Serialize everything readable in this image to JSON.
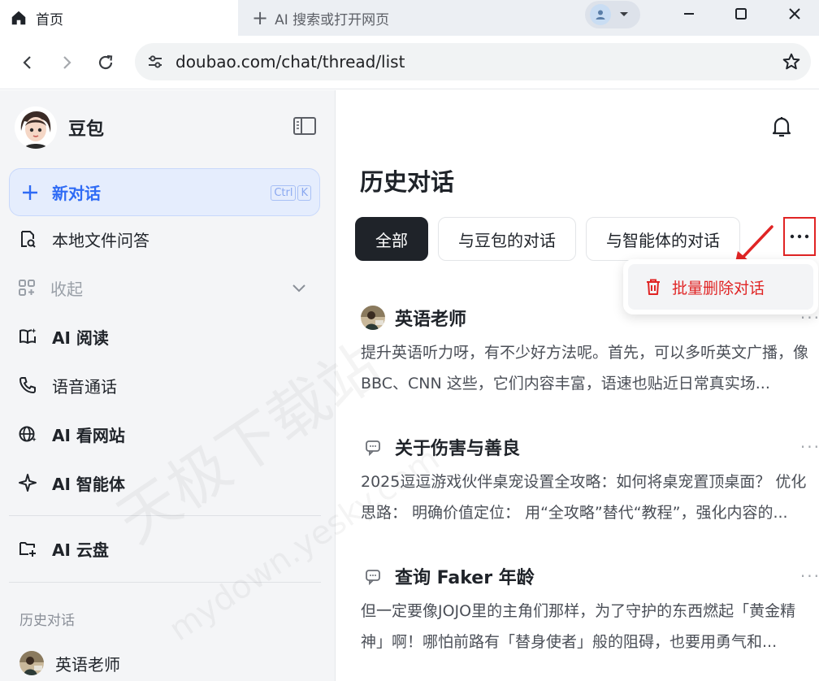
{
  "browser": {
    "active_tab_label": "首页",
    "new_tab_label": "AI 搜索或打开网页",
    "url": "doubao.com/chat/thread/list"
  },
  "sidebar": {
    "brand_name": "豆包",
    "new_chat_label": "新对话",
    "new_chat_shortcut": [
      "Ctrl",
      "K"
    ],
    "items": [
      {
        "label": "本地文件问答",
        "icon": "file-search-icon"
      },
      {
        "label": "收起",
        "icon": "grid-apps-icon",
        "muted": true
      },
      {
        "label": "AI 阅读",
        "icon": "book-reading-icon"
      },
      {
        "label": "语音通话",
        "icon": "phone-icon"
      },
      {
        "label": "AI 看网站",
        "icon": "globe-icon"
      },
      {
        "label": "AI 智能体",
        "icon": "sparkle-icon"
      },
      {
        "label": "AI 云盘",
        "icon": "cloud-folder-icon"
      }
    ],
    "history_section_title": "历史对话",
    "history_items": [
      {
        "label": "英语老师"
      }
    ]
  },
  "main": {
    "title": "历史对话",
    "filters": [
      "全部",
      "与豆包的对话",
      "与智能体的对话"
    ],
    "active_filter": "全部",
    "dropdown_item": "批量删除对话",
    "conversations": [
      {
        "title": "英语老师",
        "icon": "agent-avatar-icon",
        "preview": "提升英语听力呀，有不少好方法呢。首先，可以多听英文广播，像 BBC、CNN 这些，它们内容丰富，语速也贴近日常真实场..."
      },
      {
        "title": "关于伤害与善良",
        "icon": "chat-bubble-icon",
        "preview": "2025逗逗游戏伙伴桌宠设置全攻略：如何将桌宠置顶桌面？ 优化思路： 明确价值定位： 用“全攻略”替代“教程”，强化内容的..."
      },
      {
        "title": "查询 Faker 年龄",
        "icon": "chat-bubble-icon",
        "preview": "但一定要像JOJO里的主角们那样，为了守护的东西燃起「黄金精神」啊！哪怕前路有「替身使者」般的阻碍，也要用勇气和..."
      }
    ]
  },
  "watermark": {
    "line1": "天极下载站",
    "line2": "mydown.yesky.com"
  },
  "colors": {
    "accent": "#2f6bf5",
    "danger": "#e02424",
    "chip_active": "#1f2329"
  }
}
